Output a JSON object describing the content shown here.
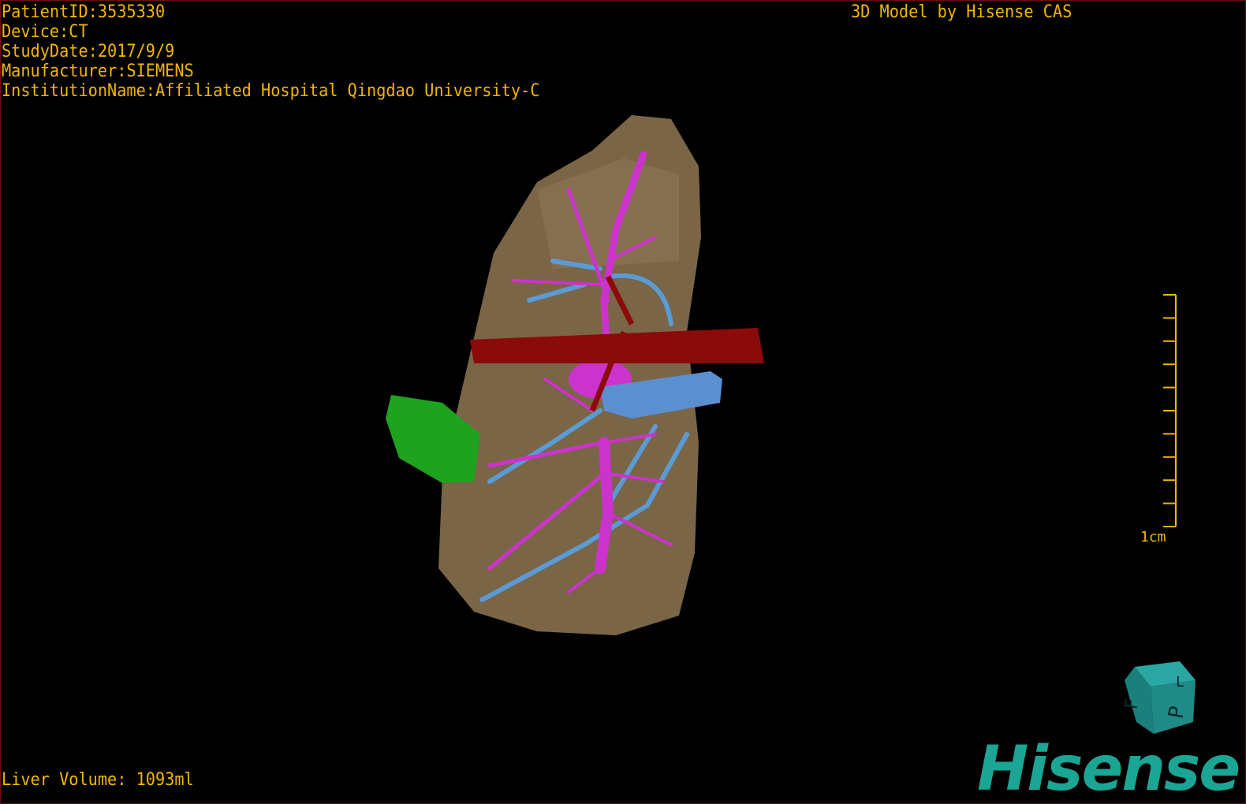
{
  "overlay": {
    "patient_id": "PatientID:3535330",
    "device": "Device:CT",
    "study_date": "StudyDate:2017/9/9",
    "manufacturer": "Manufacturer:SIEMENS",
    "institution": "InstitutionName:Affiliated Hospital Qingdao University-C",
    "brand_text": "3D Model by Hisense CAS",
    "liver_volume": "Liver Volume: 1093ml"
  },
  "scale_bar": {
    "label": "1cm"
  },
  "orientation_cube": {
    "faces": [
      "F",
      "L",
      "P"
    ],
    "color": "#1f8a86"
  },
  "logo": {
    "text": "Hisense",
    "color": "#1aa594"
  },
  "colors": {
    "text": "#f2b500",
    "liver": "#7a6546",
    "portal_vein": "#cc33cc",
    "hepatic_vein": "#5b9bd5",
    "artery": "#8b0a0a",
    "tumor": "#1fa31f"
  }
}
